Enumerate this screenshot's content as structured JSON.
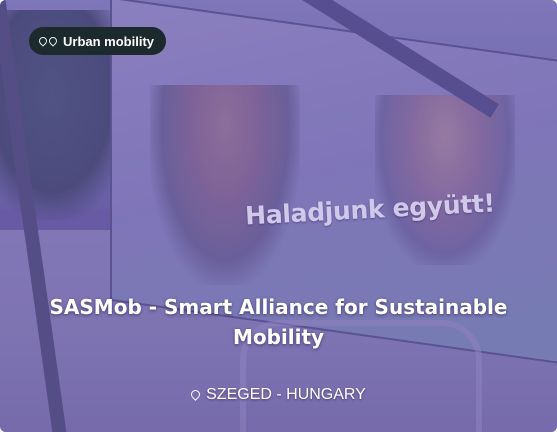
{
  "card": {
    "tag": {
      "icon": "map-pins-icon",
      "label": "Urban mobility"
    },
    "image": {
      "poster_text": "Haladjunk együtt!"
    },
    "title": "SASMob - Smart Alliance for Sustainable Mobility",
    "location": {
      "icon": "map-pin-icon",
      "label": "SZEGED - HUNGARY"
    }
  },
  "colors": {
    "overlay": "#6f64a8",
    "chip_bg": "#1c2a2e",
    "text": "#ffffff"
  }
}
